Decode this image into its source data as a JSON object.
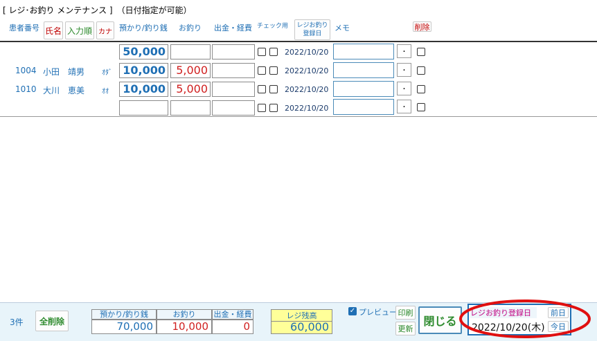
{
  "window": {
    "title": "[ レジ･お釣り メンテナンス ]　（日付指定が可能）"
  },
  "header": {
    "patient_no": "患者番号",
    "sort_name": "氏名",
    "sort_order": "入力順",
    "sort_kana": "カナ",
    "deposit": "預かり/釣り銭",
    "change": "お釣り",
    "expense": "出金・経費",
    "check": "チェック用",
    "reg_date_line1": "レジお釣り",
    "reg_date_line2": "登録日",
    "memo": "メモ",
    "delete": "削除"
  },
  "rows": [
    {
      "pid": "",
      "name": "",
      "kana": "",
      "deposit": "50,000",
      "change": "",
      "date": "2022/10/20",
      "dot": "･"
    },
    {
      "pid": "1004",
      "name": "小田　靖男",
      "kana": "ｵﾀﾞ",
      "deposit": "10,000",
      "change": "5,000",
      "date": "2022/10/20",
      "dot": "･"
    },
    {
      "pid": "1010",
      "name": "大川　恵美",
      "kana": "ｵｵ",
      "deposit": "10,000",
      "change": "5,000",
      "date": "2022/10/20",
      "dot": "･"
    },
    {
      "pid": "",
      "name": "",
      "kana": "",
      "deposit": "",
      "change": "",
      "date": "2022/10/20",
      "dot": "･"
    }
  ],
  "footer": {
    "count": "3件",
    "delete_all": "全削除",
    "tot_deposit_label": "預かり/釣り銭",
    "tot_change_label": "お釣り",
    "tot_expense_label": "出金・経費",
    "tot_deposit": "70,000",
    "tot_change": "10,000",
    "tot_expense": "0",
    "balance_label": "レジ残高",
    "balance": "60,000",
    "preview_label": "プレビュー",
    "print": "印刷",
    "update": "更新",
    "close": "閉じる",
    "reg_date_label": "レジお釣り登録日",
    "reg_date_value": "2022/10/20(木)",
    "prev_day": "前日",
    "today": "今日"
  },
  "colors": {
    "accent": "#1f6fb4",
    "danger": "#d02020",
    "balance_bg": "#ffff99",
    "annotation": "#e01010"
  }
}
